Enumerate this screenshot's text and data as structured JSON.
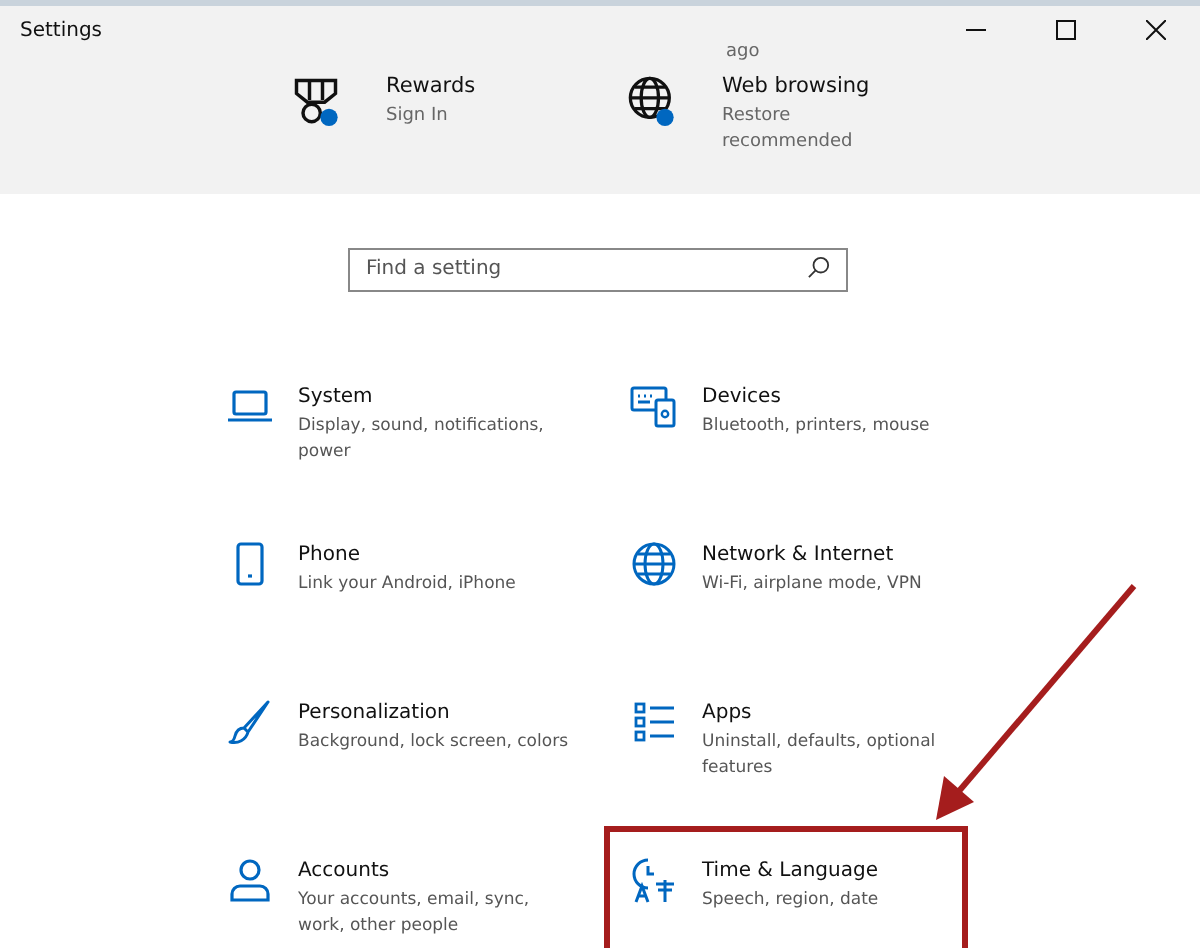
{
  "window": {
    "title": "Settings"
  },
  "header": {
    "partial_text": "ago",
    "tiles": [
      {
        "kind": "rewards",
        "title": "Rewards",
        "subtitle": "Sign In"
      },
      {
        "kind": "web",
        "title": "Web browsing",
        "subtitle": "Restore recommended"
      }
    ]
  },
  "search": {
    "placeholder": "Find a setting"
  },
  "categories": [
    {
      "kind": "system",
      "title": "System",
      "subtitle": "Display, sound, notifications, power",
      "highlighted": false
    },
    {
      "kind": "devices",
      "title": "Devices",
      "subtitle": "Bluetooth, printers, mouse",
      "highlighted": false
    },
    {
      "kind": "phone",
      "title": "Phone",
      "subtitle": "Link your Android, iPhone",
      "highlighted": false
    },
    {
      "kind": "network",
      "title": "Network & Internet",
      "subtitle": "Wi-Fi, airplane mode, VPN",
      "highlighted": false
    },
    {
      "kind": "personalization",
      "title": "Personalization",
      "subtitle": "Background, lock screen, colors",
      "highlighted": false
    },
    {
      "kind": "apps",
      "title": "Apps",
      "subtitle": "Uninstall, defaults, optional features",
      "highlighted": false
    },
    {
      "kind": "accounts",
      "title": "Accounts",
      "subtitle": "Your accounts, email, sync, work, other people",
      "highlighted": false
    },
    {
      "kind": "time",
      "title": "Time & Language",
      "subtitle": "Speech, region, date",
      "highlighted": true
    }
  ]
}
